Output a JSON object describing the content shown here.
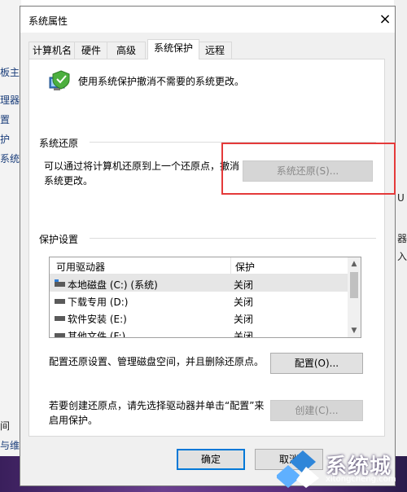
{
  "background": {
    "left_fragments": [
      "板主",
      "理器",
      "置",
      "护",
      "系统设",
      "间",
      "与维"
    ],
    "right_fragments": [
      "U",
      "器",
      "入"
    ]
  },
  "dialog": {
    "title": "系统属性",
    "close_label": "×",
    "tabs": [
      {
        "label": "计算机名",
        "active": false
      },
      {
        "label": "硬件",
        "active": false
      },
      {
        "label": "高级",
        "active": false
      },
      {
        "label": "系统保护",
        "active": true
      },
      {
        "label": "远程",
        "active": false
      }
    ],
    "description": "使用系统保护撤消不需要的系统更改。",
    "restore_section": {
      "heading": "系统还原",
      "text": "可以通过将计算机还原到上一个还原点，撤消系统更改。",
      "button_label": "系统还原(S)..."
    },
    "protection_section": {
      "heading": "保护设置",
      "columns": [
        "可用驱动器",
        "保护"
      ],
      "drives": [
        {
          "name": "本地磁盘 (C:) (系统)",
          "protection": "关闭",
          "icon": "system-drive-icon"
        },
        {
          "name": "下载专用 (D:)",
          "protection": "关闭",
          "icon": "drive-icon"
        },
        {
          "name": "软件安装 (E:)",
          "protection": "关闭",
          "icon": "drive-icon"
        },
        {
          "name": "其他文件 (F:)",
          "protection": "关闭",
          "icon": "drive-icon"
        }
      ],
      "configure_text": "配置还原设置、管理磁盘空间，并且删除还原点。",
      "configure_button": "配置(O)...",
      "create_text": "若要创建还原点，请先选择驱动器并单击“配置”来启用保护。",
      "create_button": "创建(C)..."
    },
    "footer": {
      "ok": "确定",
      "cancel": "取消"
    }
  },
  "watermark": {
    "text": "系统城",
    "url": "xitongcheng.com"
  },
  "colors": {
    "accent": "#0078d7",
    "highlight_box": "#e43a3a"
  }
}
